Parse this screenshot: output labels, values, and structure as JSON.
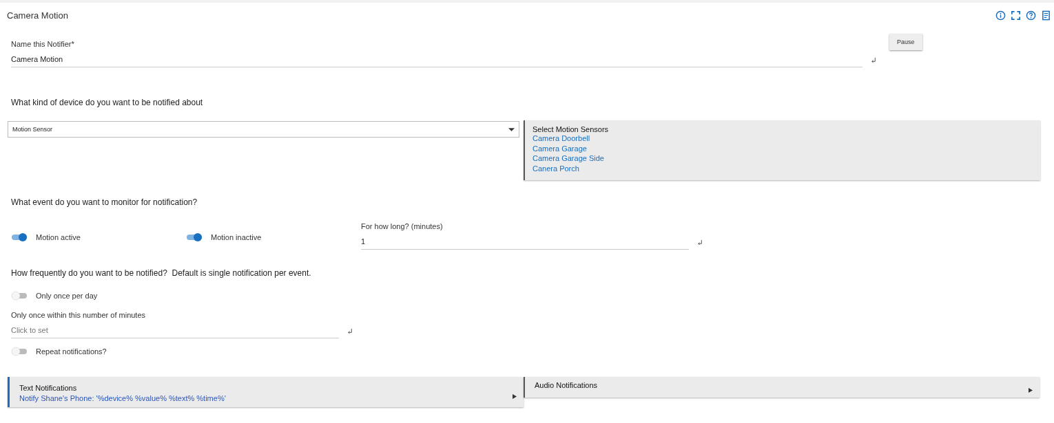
{
  "title": "Camera Motion",
  "name_field": {
    "label": "Name this Notifier*",
    "value": "Camera Motion"
  },
  "pause_button": "Pause",
  "device_question": "What kind of device do you want to be notified about",
  "device_select": {
    "value": "Motion Sensor"
  },
  "sensor_panel": {
    "title": "Select Motion Sensors",
    "items": [
      "Camera Doorbell",
      "Camera Garage",
      "Camera Garage Side",
      "Canera Porch"
    ]
  },
  "event_question": "What event do you want to monitor for notification?",
  "event_toggles": [
    {
      "label": "Motion active",
      "on": true
    },
    {
      "label": "Motion inactive",
      "on": true
    }
  ],
  "duration_field": {
    "label": "For how long? (minutes)",
    "value": "1"
  },
  "frequency_question": "How frequently do you want to be notified?  Default is single notification per event.",
  "once_per_day": {
    "label": "Only once per day",
    "on": false
  },
  "minutes_field": {
    "label": "Only once within this number of minutes",
    "placeholder": "Click to set"
  },
  "repeat": {
    "label": "Repeat notifications?",
    "on": false
  },
  "sections": [
    {
      "title": "Text Notifications",
      "summary": "Notify Shane's Phone: '%device% %value% %text% %time%'",
      "configured": true
    },
    {
      "title": "Audio Notifications",
      "configured": false
    }
  ]
}
